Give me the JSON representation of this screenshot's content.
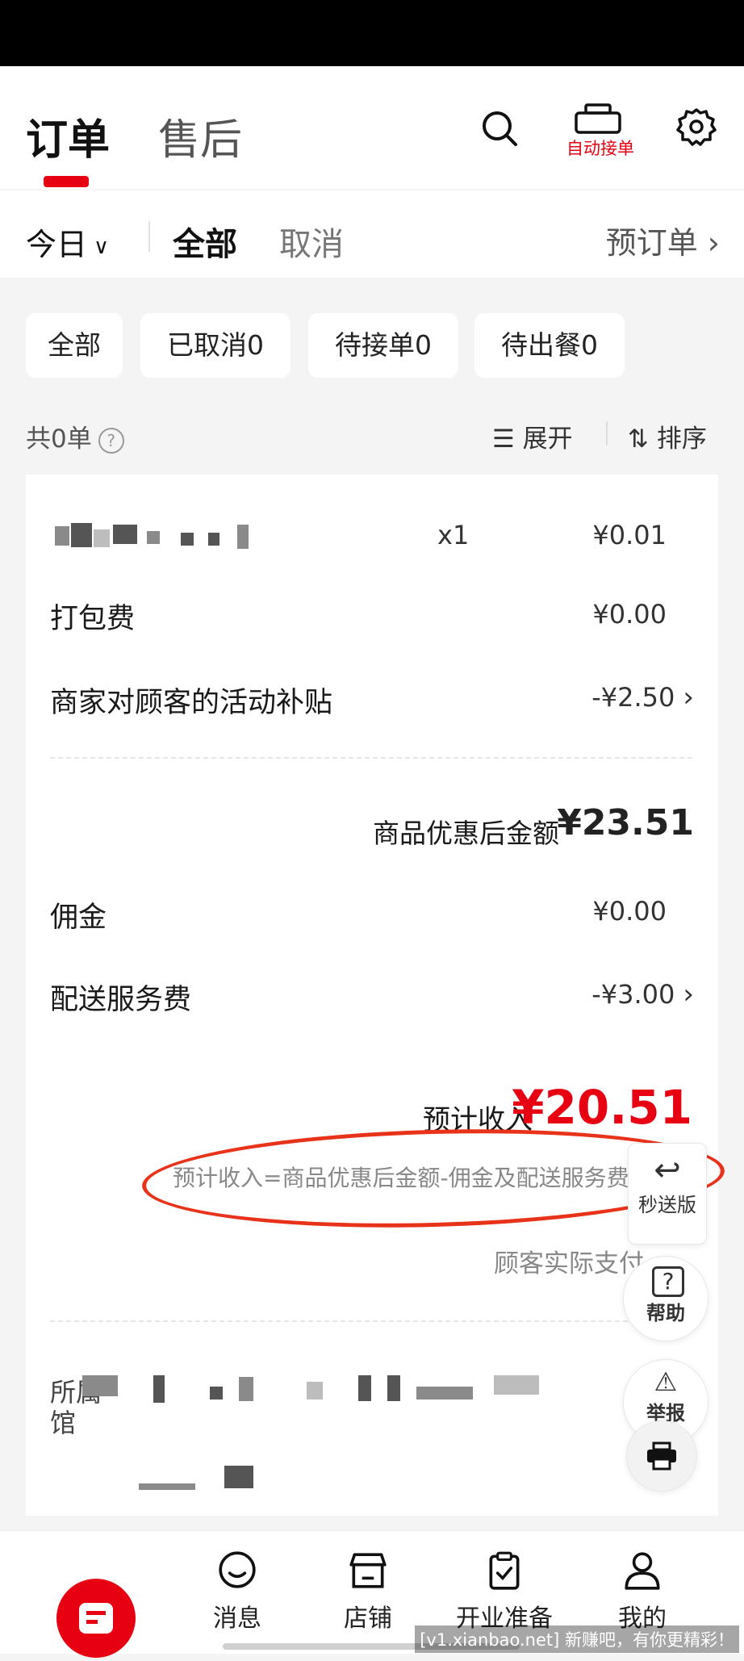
{
  "header": {
    "tab_orders": "订单",
    "tab_aftersales": "售后",
    "auto_accept_label": "自动接单"
  },
  "filterbar": {
    "date_filter": "今日",
    "tab_all": "全部",
    "tab_cancel": "取消",
    "preorder": "预订单"
  },
  "chips": [
    "全部",
    "已取消0",
    "待接单0",
    "待出餐0"
  ],
  "list": {
    "count": "共0单",
    "expand": "展开",
    "sort": "排序"
  },
  "order": {
    "item_qty": "x1",
    "item_price": "¥0.01",
    "packing_label": "打包费",
    "packing_value": "¥0.00",
    "subsidy_label": "商家对顾客的活动补贴",
    "subsidy_value": "-¥2.50",
    "after_discount_label": "商品优惠后金额",
    "after_discount_value": "¥23.51",
    "commission_label": "佣金",
    "commission_value": "¥0.00",
    "delivery_label": "配送服务费",
    "delivery_value": "-¥3.00",
    "income_label": "预计收入",
    "income_value": "¥20.51",
    "formula": "预计收入=商品优惠后金额-佣金及配送服务费",
    "customer_paid": "顾客实际支付",
    "shop_label": "所属",
    "shop_label2": "馆"
  },
  "floating": {
    "fast_delivery": "秒送版",
    "help": "帮助",
    "report": "举报"
  },
  "nav": {
    "messages": "消息",
    "store": "店铺",
    "opening_prep": "开业准备",
    "mine": "我的"
  },
  "watermark": "[v1.xianbao.net] 新赚吧，有你更精彩！",
  "colors": {
    "accent": "#e60012",
    "annotation": "#e8321a"
  }
}
